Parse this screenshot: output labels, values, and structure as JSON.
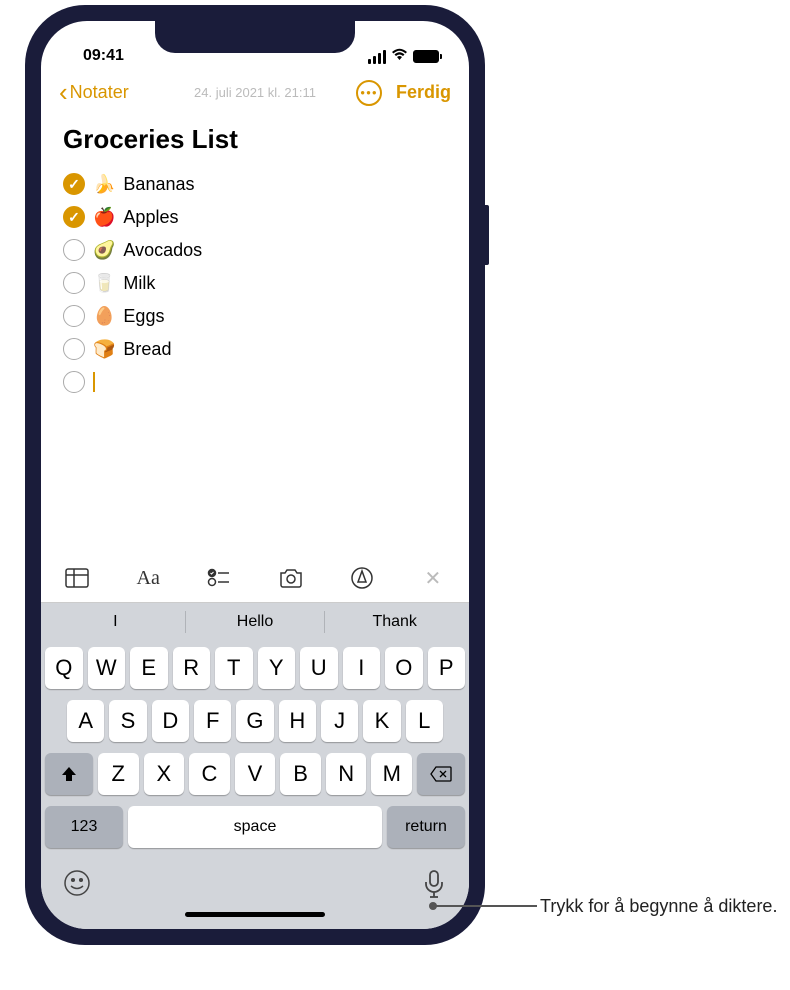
{
  "status_bar": {
    "time": "09:41"
  },
  "nav": {
    "back_label": "Notater",
    "timestamp": "24. juli 2021 kl. 21:11",
    "done_label": "Ferdig"
  },
  "note": {
    "title": "Groceries List",
    "items": [
      {
        "checked": true,
        "emoji": "🍌",
        "text": "Bananas"
      },
      {
        "checked": true,
        "emoji": "🍎",
        "text": "Apples"
      },
      {
        "checked": false,
        "emoji": "🥑",
        "text": "Avocados"
      },
      {
        "checked": false,
        "emoji": "🥛",
        "text": "Milk"
      },
      {
        "checked": false,
        "emoji": "🥚",
        "text": "Eggs"
      },
      {
        "checked": false,
        "emoji": "🍞",
        "text": "Bread"
      }
    ]
  },
  "suggestions": [
    "I",
    "Hello",
    "Thank"
  ],
  "keyboard": {
    "row1": [
      "Q",
      "W",
      "E",
      "R",
      "T",
      "Y",
      "U",
      "I",
      "O",
      "P"
    ],
    "row2": [
      "A",
      "S",
      "D",
      "F",
      "G",
      "H",
      "J",
      "K",
      "L"
    ],
    "row3": [
      "Z",
      "X",
      "C",
      "V",
      "B",
      "N",
      "M"
    ],
    "numeric_label": "123",
    "space_label": "space",
    "return_label": "return"
  },
  "callout": {
    "text": "Trykk for å begynne å diktere."
  }
}
